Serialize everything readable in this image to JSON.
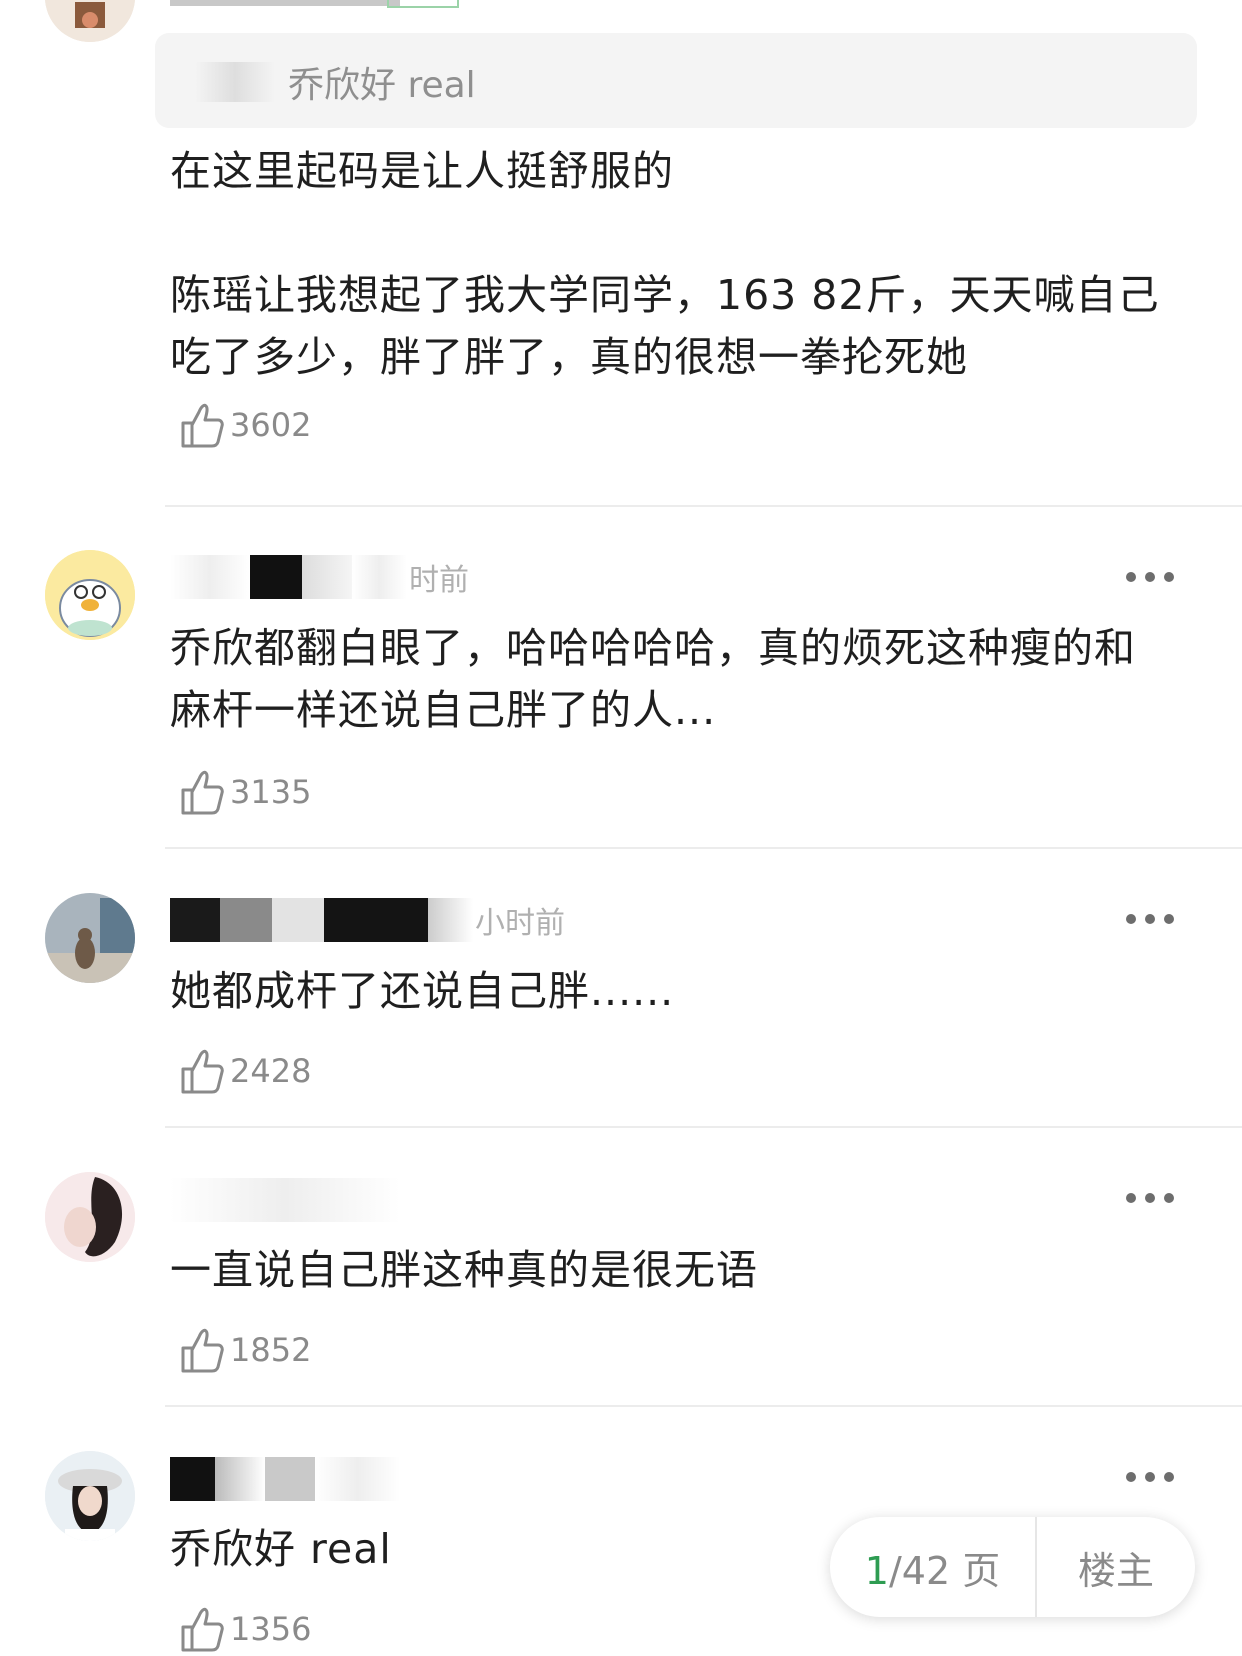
{
  "top_comment": {
    "quote_text": "乔欣好 real",
    "content": "在这里起码是让人挺舒服的\n\n陈瑶让我想起了我大学同学，163 82斤，天天喊自己吃了多少，胖了胖了，真的很想一拳抡死她",
    "likes": "3602"
  },
  "comments": [
    {
      "time": "时前",
      "content": "乔欣都翻白眼了，哈哈哈哈哈，真的烦死这种瘦的和麻杆一样还说自己胖了的人...",
      "likes": "3135",
      "avatar_icon": "duck-avatar"
    },
    {
      "time": "小时前",
      "content": "她都成杆了还说自己胖......",
      "likes": "2428",
      "avatar_icon": "cat-photo-avatar"
    },
    {
      "time": "",
      "content": "一直说自己胖这种真的是很无语",
      "likes": "1852",
      "avatar_icon": "portrait-avatar"
    },
    {
      "time": "",
      "content": "乔欣好 real",
      "likes": "1356",
      "avatar_icon": "girl-hat-avatar"
    }
  ],
  "pager": {
    "current": "1",
    "rest": "/42 页",
    "owner_label": "楼主"
  },
  "colors": {
    "accent_green": "#2e9c52",
    "muted_text": "#8a8a8a"
  }
}
